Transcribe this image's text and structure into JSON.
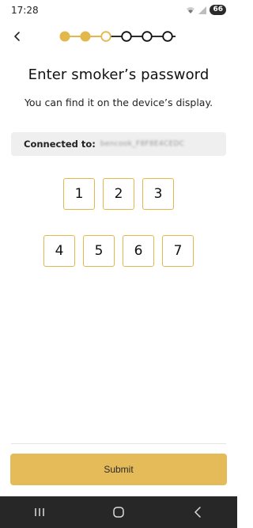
{
  "status_bar": {
    "time": "17:28",
    "battery": "66",
    "icons": [
      "wifi-icon",
      "signal-icon",
      "battery-icon"
    ]
  },
  "header": {
    "back_icon": "chevron-left-icon",
    "steps_total": 6,
    "steps_completed": 2,
    "current_step": 3
  },
  "title": "Enter smoker’s password",
  "subtitle": "You can find it on the device’s display.",
  "connection": {
    "label": "Connected to:",
    "device_name": "bencook_F8F8E4CEDC"
  },
  "pin": {
    "row1": [
      "1",
      "2",
      "3"
    ],
    "row2": [
      "4",
      "5",
      "6",
      "7"
    ]
  },
  "submit_label": "Submit",
  "nav": {
    "icons": [
      "recent-apps-icon",
      "home-icon",
      "back-icon"
    ]
  },
  "colors": {
    "accent": "#E2B84C",
    "button": "#E5BB5A",
    "nav_bar": "#272727",
    "connected_bg": "#EFEFEF"
  }
}
